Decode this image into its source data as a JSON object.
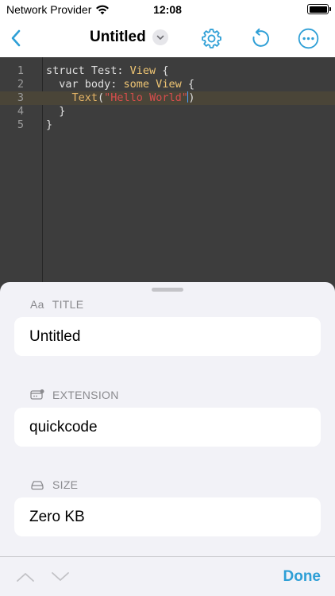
{
  "status_bar": {
    "carrier": "Network Provider",
    "time": "12:08"
  },
  "navbar": {
    "title": "Untitled",
    "icons": [
      "chevron-left-icon",
      "chevron-down-icon",
      "gear-icon",
      "undo-icon",
      "ellipsis-icon"
    ]
  },
  "editor": {
    "line_numbers": [
      "1",
      "2",
      "3",
      "4",
      "5"
    ],
    "active_line": 3,
    "lines": [
      {
        "c1": "struct Test: ",
        "c2": "View",
        "c3": " {"
      },
      {
        "c1": "  var body: ",
        "c2": "some View",
        "c3": " {"
      },
      {
        "c1": "    ",
        "fn": "Text",
        "p1": "(",
        "str": "\"Hello World\"",
        "p2": ")"
      },
      {
        "c1": "  }"
      },
      {
        "c1": "}"
      }
    ]
  },
  "sheet": {
    "title_section": {
      "icon_text": "Aa",
      "label": "TITLE",
      "value": "Untitled"
    },
    "extension_section": {
      "icon": "file-extension-icon",
      "label": "EXTENSION",
      "value": "quickcode"
    },
    "size_section": {
      "icon": "drive-icon",
      "label": "SIZE",
      "value": "Zero KB"
    }
  },
  "toolbar": {
    "done_label": "Done",
    "icons": [
      "chevron-up-icon",
      "chevron-down-icon"
    ]
  },
  "colors": {
    "accent": "#2e9fd6",
    "editor_bg": "#3d3d3d",
    "sheet_bg": "#f2f2f7"
  }
}
